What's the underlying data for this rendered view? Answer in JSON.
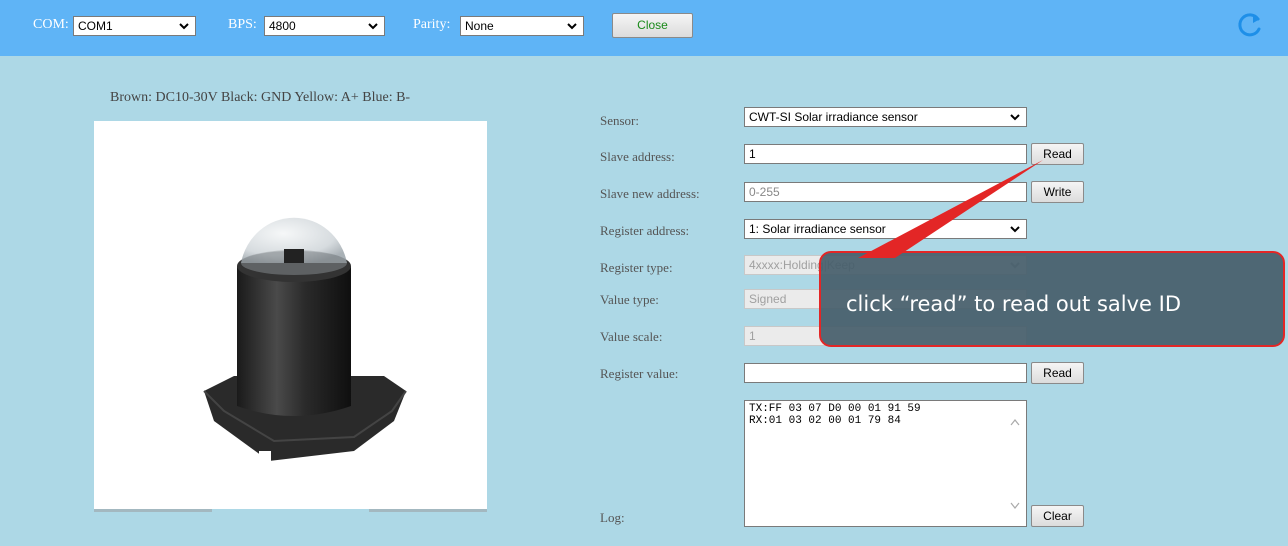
{
  "toolbar": {
    "com_label": "COM:",
    "com_value": "COM1",
    "bps_label": "BPS:",
    "bps_value": "4800",
    "parity_label": "Parity:",
    "parity_value": "None",
    "close_label": "Close",
    "refresh_icon": "refresh-icon"
  },
  "left": {
    "wiring": "Brown: DC10-30V  Black: GND  Yellow: A+  Blue: B-"
  },
  "form": {
    "sensor_label": "Sensor:",
    "sensor_value": "CWT-SI Solar irradiance sensor",
    "slave_label": "Slave address:",
    "slave_value": "1",
    "read_label": "Read",
    "new_addr_label": "Slave new address:",
    "new_addr_placeholder": "0-255",
    "write_label": "Write",
    "reg_addr_label": "Register address:",
    "reg_addr_value": "1: Solar irradiance sensor",
    "reg_type_label": "Register type:",
    "reg_type_value": "4xxxx:Holding|Keep",
    "value_type_label": "Value type:",
    "value_type_value": "Signed",
    "value_scale_label": "Value scale:",
    "value_scale_value": "1",
    "reg_value_label": "Register value:",
    "reg_value_value": "",
    "reg_read_label": "Read",
    "log_label": "Log:",
    "log_text": "TX:FF 03 07 D0 00 01 91 59\nRX:01 03 02 00 01 79 84",
    "clear_label": "Clear"
  },
  "callout": {
    "text": "click “read” to read out salve ID"
  },
  "colors": {
    "topbar": "#5fb4f6",
    "background": "#add8e6",
    "callout_border": "#e32626"
  }
}
